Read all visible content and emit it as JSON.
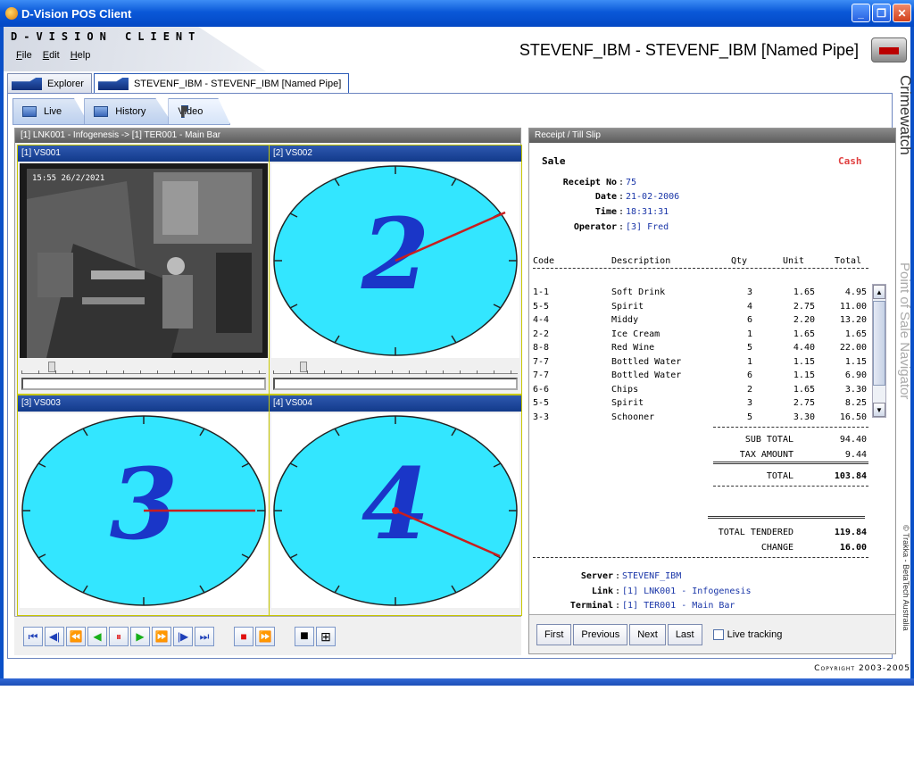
{
  "window": {
    "title": "D-Vision POS Client"
  },
  "header": {
    "brand": "D-VISION CLIENT",
    "connection_title": "STEVENF_IBM - STEVENF_IBM [Named Pipe]"
  },
  "menu": [
    "File",
    "Edit",
    "Help"
  ],
  "outer_tabs": [
    "Explorer",
    "STEVENF_IBM - STEVENF_IBM [Named Pipe]"
  ],
  "inner_tabs": [
    "Live",
    "History",
    "Video"
  ],
  "video_panel": {
    "title": "[1] LNK001 - Infogenesis -> [1] TER001 - Main Bar",
    "cams": [
      {
        "name": "[1] VS001",
        "timestamp": "15:55 26/2/2021",
        "number": ""
      },
      {
        "name": "[2] VS002",
        "number": "2"
      },
      {
        "name": "[3] VS003",
        "number": "3"
      },
      {
        "name": "[4] VS004",
        "number": "4"
      }
    ]
  },
  "receipt": {
    "panel_title": "Receipt / Till Slip",
    "type": "Sale",
    "payment": "Cash",
    "receipt_no_label": "Receipt No",
    "receipt_no": "75",
    "date_label": "Date",
    "date": "21-02-2006",
    "time_label": "Time",
    "time": "18:31:31",
    "operator_label": "Operator",
    "operator": "[3] Fred",
    "columns": [
      "Code",
      "Description",
      "Qty",
      "Unit",
      "Total"
    ],
    "items": [
      {
        "code": "1-1",
        "description": "Soft Drink",
        "qty": "3",
        "unit": "1.65",
        "total": "4.95"
      },
      {
        "code": "5-5",
        "description": "Spirit",
        "qty": "4",
        "unit": "2.75",
        "total": "11.00"
      },
      {
        "code": "4-4",
        "description": "Middy",
        "qty": "6",
        "unit": "2.20",
        "total": "13.20"
      },
      {
        "code": "2-2",
        "description": "Ice Cream",
        "qty": "1",
        "unit": "1.65",
        "total": "1.65"
      },
      {
        "code": "8-8",
        "description": "Red Wine",
        "qty": "5",
        "unit": "4.40",
        "total": "22.00"
      },
      {
        "code": "7-7",
        "description": "Bottled Water",
        "qty": "1",
        "unit": "1.15",
        "total": "1.15"
      },
      {
        "code": "7-7",
        "description": "Bottled Water",
        "qty": "6",
        "unit": "1.15",
        "total": "6.90"
      },
      {
        "code": "6-6",
        "description": "Chips",
        "qty": "2",
        "unit": "1.65",
        "total": "3.30"
      },
      {
        "code": "5-5",
        "description": "Spirit",
        "qty": "3",
        "unit": "2.75",
        "total": "8.25"
      },
      {
        "code": "3-3",
        "description": "Schooner",
        "qty": "5",
        "unit": "3.30",
        "total": "16.50"
      }
    ],
    "sub_total_label": "SUB TOTAL",
    "sub_total": "94.40",
    "tax_label": "TAX AMOUNT",
    "tax": "9.44",
    "total_label": "TOTAL",
    "total": "103.84",
    "tendered_label": "TOTAL TENDERED",
    "tendered": "119.84",
    "change_label": "CHANGE",
    "change": "16.00",
    "server_label": "Server",
    "server": "STEVENF_IBM",
    "link_label": "Link",
    "link": "[1] LNK001 - Infogenesis",
    "terminal_label": "Terminal",
    "terminal": "[1] TER001 - Main Bar"
  },
  "receipt_nav": {
    "first": "First",
    "previous": "Previous",
    "next": "Next",
    "last": "Last",
    "live_tracking": "Live tracking"
  },
  "side_labels": {
    "crimewatch": "Crimewatch",
    "pos_nav": "Point of Sale Navigator",
    "trakka": "© Trakka - BetaTech Australia"
  },
  "footer": {
    "copyright": "Copyright 2003-2005"
  },
  "colors": {
    "clock_face": "#33e6ff",
    "digit": "#1a36c8",
    "hand": "#c81e1e",
    "xp_blue": "#0a58d8"
  }
}
